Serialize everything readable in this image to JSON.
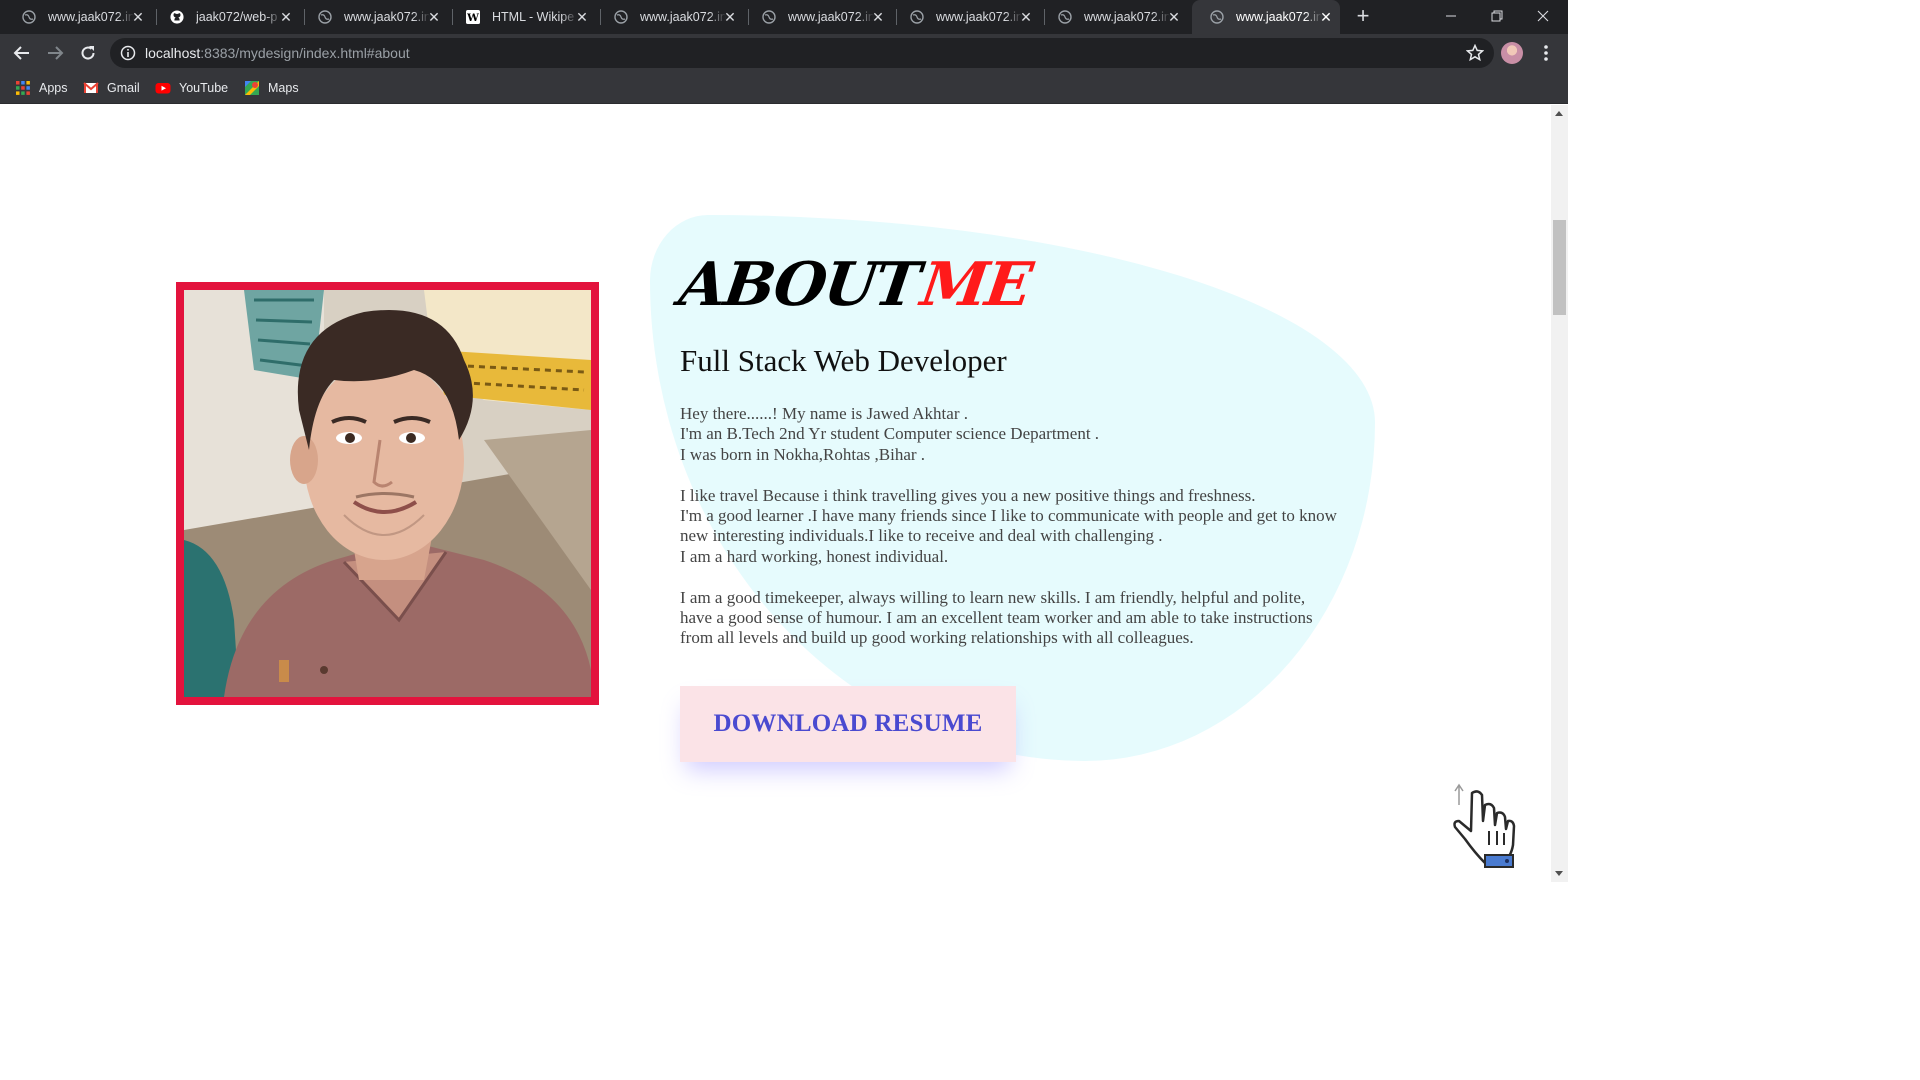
{
  "browser": {
    "tabs": [
      {
        "title": "www.jaak072.in",
        "icon": "globe-icon"
      },
      {
        "title": "jaak072/web-p",
        "icon": "github-icon"
      },
      {
        "title": "www.jaak072.in",
        "icon": "globe-icon"
      },
      {
        "title": "HTML - Wikipe",
        "icon": "wikipedia-icon"
      },
      {
        "title": "www.jaak072.in",
        "icon": "globe-icon"
      },
      {
        "title": "www.jaak072.in",
        "icon": "globe-icon"
      },
      {
        "title": "www.jaak072.in",
        "icon": "globe-icon"
      },
      {
        "title": "www.jaak072.in",
        "icon": "globe-icon"
      },
      {
        "title": "www.jaak072.in",
        "icon": "globe-icon",
        "active": true
      }
    ],
    "address": {
      "host": "localhost",
      "path": ":8383/mydesign/index.html#about"
    },
    "bookmarks": [
      {
        "label": "Apps",
        "icon": "apps-grid-icon"
      },
      {
        "label": "Gmail",
        "icon": "gmail-icon"
      },
      {
        "label": "YouTube",
        "icon": "youtube-icon"
      },
      {
        "label": "Maps",
        "icon": "maps-icon"
      }
    ]
  },
  "about": {
    "title_part1": "ABOUT",
    "title_part2": "ME",
    "role": "Full Stack Web Developer",
    "bio": [
      [
        "Hey there......! My name is Jawed Akhtar .",
        "I'm an B.Tech 2nd Yr student Computer science Department .",
        "I was born in Nokha,Rohtas ,Bihar ."
      ],
      [
        "I like travel Because i think travelling gives you a new positive things and freshness.",
        "I'm a good learner .I have many friends since I like to communicate with people and get to know new interesting individuals.I like to receive and deal with challenging .",
        "I am a hard working, honest individual."
      ],
      [
        "I am a good timekeeper, always willing to learn new skills. I am friendly, helpful and polite, have a good sense of humour. I am an excellent team worker and am able to take instructions from all levels and build up good working relationships with all colleagues."
      ]
    ],
    "button_label": "DOWNLOAD RESUME",
    "colors": {
      "frame": "#e3133d",
      "title_accent": "#ff1a1a",
      "blob": "#e6fbfd",
      "button_bg": "#fbe3e7",
      "button_text": "#4a4ad0"
    }
  }
}
